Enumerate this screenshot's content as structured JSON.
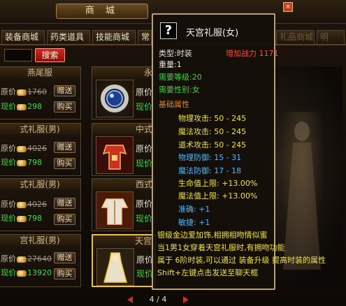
{
  "window": {
    "title": "商 城",
    "close_label": "×"
  },
  "tabs": [
    {
      "label": "装备商城"
    },
    {
      "label": "药类道具"
    },
    {
      "label": "技能商城"
    },
    {
      "label": "常"
    },
    {
      "label": "礼品商城"
    },
    {
      "label": "明"
    }
  ],
  "search": {
    "button_label": "搜索",
    "value": ""
  },
  "price_labels": {
    "original": "原价",
    "current": "现价"
  },
  "buttons": {
    "gift": "赠送",
    "buy": "购买"
  },
  "left_items": [
    {
      "name": "燕尾服",
      "original_price": "1760",
      "current_price": "298"
    },
    {
      "name": "式礼服(男)",
      "original_price": "4026",
      "current_price": "798"
    },
    {
      "name": "式礼服(男)",
      "original_price": "4026",
      "current_price": "798"
    },
    {
      "name": "宫礼服(男)",
      "original_price": "27640",
      "current_price": "13920"
    }
  ],
  "middle_items": [
    {
      "name": "永",
      "original_label": "原价",
      "current_label": "现价"
    },
    {
      "name": "中式",
      "original_label": "原价",
      "current_label": "现价"
    },
    {
      "name": "西式",
      "original_label": "原价",
      "current_label": "现价"
    },
    {
      "name": "天宫",
      "original_label": "原价",
      "current_label": "现价"
    }
  ],
  "preview_labels": {
    "name_faint": "预览"
  },
  "pager": {
    "current": "4",
    "separator": "/",
    "total": "4"
  },
  "tooltip": {
    "icon_label": "?",
    "item_name": "天宫礼服(女)",
    "type": "类型:时装",
    "power": "增加战力 1171",
    "weight": "重量:1",
    "req_level": "需要等级:20",
    "req_gender": "需要性别:女",
    "base_attr_title": "基础属性",
    "stats": [
      {
        "label": "物理攻击:",
        "value": "50 - 245"
      },
      {
        "label": "魔法攻击:",
        "value": "50 - 245"
      },
      {
        "label": "道术攻击:",
        "value": "50 - 245"
      },
      {
        "label": "物理防御:",
        "value": "15 - 31"
      },
      {
        "label": "魔法防御:",
        "value": "17 - 18"
      },
      {
        "label": "生命值上限:",
        "value": "+13.00%"
      },
      {
        "label": "魔法值上限:",
        "value": "+13.00%"
      },
      {
        "label": "准确:",
        "value": "+1"
      },
      {
        "label": "敏捷:",
        "value": "+1"
      }
    ],
    "description": [
      "银级金边爱加饰,相拥相吻情似蜜",
      "当1男1女穿着天宫礼服时,有拥吻功能",
      "属于 6阶时装,可以通过 装备升级 提高时装的属性"
    ],
    "hint": "Shift+左键点击发送至聊天框"
  },
  "colors": {
    "accent_gold": "#b8a274",
    "current_price_green": "#3fd94a",
    "search_red": "#c8201a",
    "selected_border": "#f0c22a"
  }
}
